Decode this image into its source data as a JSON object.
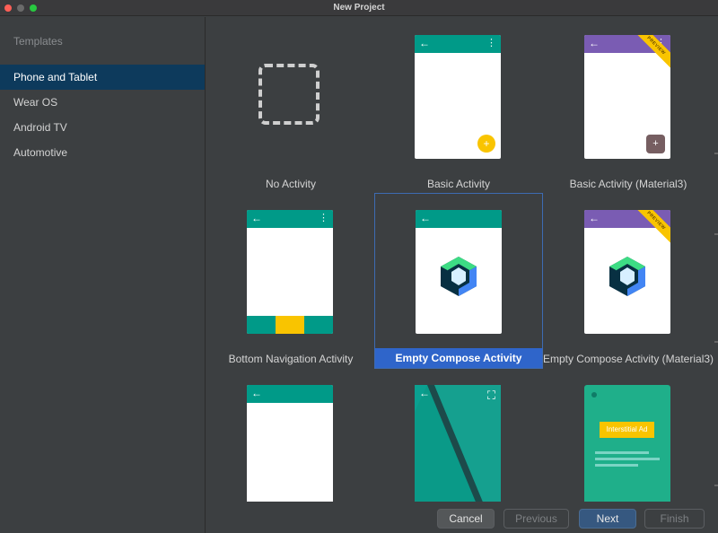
{
  "window": {
    "title": "New Project"
  },
  "sidebar": {
    "heading": "Templates",
    "items": [
      {
        "label": "Phone and Tablet",
        "selected": true
      },
      {
        "label": "Wear OS",
        "selected": false
      },
      {
        "label": "Android TV",
        "selected": false
      },
      {
        "label": "Automotive",
        "selected": false
      }
    ]
  },
  "templates": [
    {
      "label": "No Activity"
    },
    {
      "label": "Basic Activity"
    },
    {
      "label": "Basic Activity (Material3)",
      "badge": "PREVIEW"
    },
    {
      "label": "Bottom Navigation Activity"
    },
    {
      "label": "Empty Compose Activity",
      "selected": true
    },
    {
      "label": "Empty Compose Activity (Material3)",
      "badge": "PREVIEW"
    },
    {
      "label": ""
    },
    {
      "label": ""
    },
    {
      "label": "",
      "ad_text": "Interstitial Ad"
    }
  ],
  "footer": {
    "cancel": "Cancel",
    "previous": "Previous",
    "next": "Next",
    "finish": "Finish"
  },
  "icons": {
    "back": "←",
    "menu": "⋮",
    "plus": "+"
  },
  "colors": {
    "accent": "#2f65ca",
    "appbar": "#009a88",
    "appbar_material3": "#7a5cb3",
    "fab": "#f9c400"
  }
}
